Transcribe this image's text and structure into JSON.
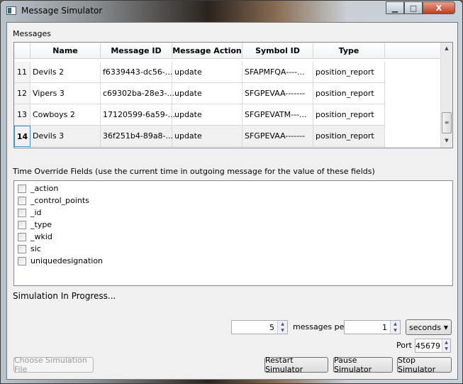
{
  "window": {
    "title": "Message Simulator",
    "minimize": "▁",
    "maximize": "□",
    "close": "X"
  },
  "messages": {
    "label": "Messages",
    "columns": [
      "Name",
      "Message ID",
      "Message Action",
      "Symbol ID",
      "Type"
    ],
    "rows": [
      {
        "num": "11",
        "name": "Devils 2",
        "id": "f6339443-dc56-...",
        "action": "update",
        "symbol": "SFAPMFQA----...",
        "type": "position_report"
      },
      {
        "num": "12",
        "name": "Vipers 3",
        "id": "c69302ba-28e3-...",
        "action": "update",
        "symbol": "SFGPEVAA-------",
        "type": "position_report"
      },
      {
        "num": "13",
        "name": "Cowboys 2",
        "id": "17120599-6a59-...",
        "action": "update",
        "symbol": "SFGPEVATM---...",
        "type": "position_report"
      },
      {
        "num": "14",
        "name": "Devils 3",
        "id": "36f251b4-89a8-...",
        "action": "update",
        "symbol": "SFGPEVAA-------",
        "type": "position_report"
      }
    ],
    "selected_row": "14"
  },
  "time_override": {
    "label": "Time Override Fields (use the current time in outgoing message for the value of these fields)",
    "fields": [
      "_action",
      "_control_points",
      "_id",
      "_type",
      "_wkid",
      "sic",
      "uniquedesignation"
    ]
  },
  "status": "Simulation In Progress...",
  "rate": {
    "count": "5",
    "per_label": "messages per",
    "interval": "1",
    "unit": "seconds"
  },
  "port": {
    "label": "Port",
    "value": "45679"
  },
  "buttons": {
    "choose": "Choose Simulation File",
    "restart": "Restart Simulator",
    "pause": "Pause Simulator",
    "stop": "Stop Simulator"
  }
}
